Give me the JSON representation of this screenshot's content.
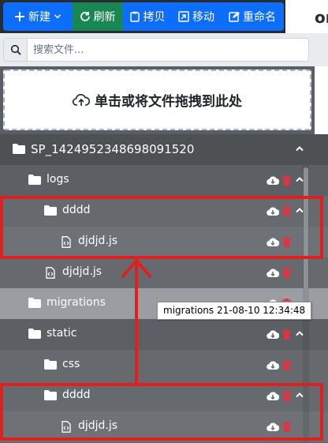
{
  "toolbar": {
    "new_label": "新建",
    "refresh_label": "刷新",
    "copy_label": "拷贝",
    "move_label": "移动",
    "rename_label": "重命名",
    "right_fragment": "ork"
  },
  "search": {
    "placeholder": "搜索文件..."
  },
  "dropzone": {
    "label": "单击或将文件拖拽到此处"
  },
  "tree": {
    "root": "SP_1424952348698091520",
    "rows": [
      {
        "name": "logs",
        "type": "folder"
      },
      {
        "name": "dddd",
        "type": "folder"
      },
      {
        "name": "djdjd.js",
        "type": "file"
      },
      {
        "name": "djdjd.js",
        "type": "file"
      },
      {
        "name": "migrations",
        "type": "folder",
        "hovered": true
      },
      {
        "name": "static",
        "type": "folder"
      },
      {
        "name": "css",
        "type": "folder"
      },
      {
        "name": "dddd",
        "type": "folder"
      },
      {
        "name": "djdjd.js",
        "type": "file"
      }
    ]
  },
  "tooltip": {
    "text": "migrations 21-08-10 12:34:48"
  },
  "colors": {
    "primary": "#0d6efd",
    "success": "#198754",
    "delete": "#dc3545",
    "annotation": "#e02020"
  },
  "icons": [
    "plus-icon",
    "chevron-down-icon",
    "refresh-icon",
    "copy-icon",
    "move-icon",
    "rename-icon",
    "search-icon",
    "cloud-upload-icon",
    "folder-icon",
    "file-code-icon",
    "cloud-download-icon",
    "trash-icon",
    "chevron-up-icon"
  ]
}
